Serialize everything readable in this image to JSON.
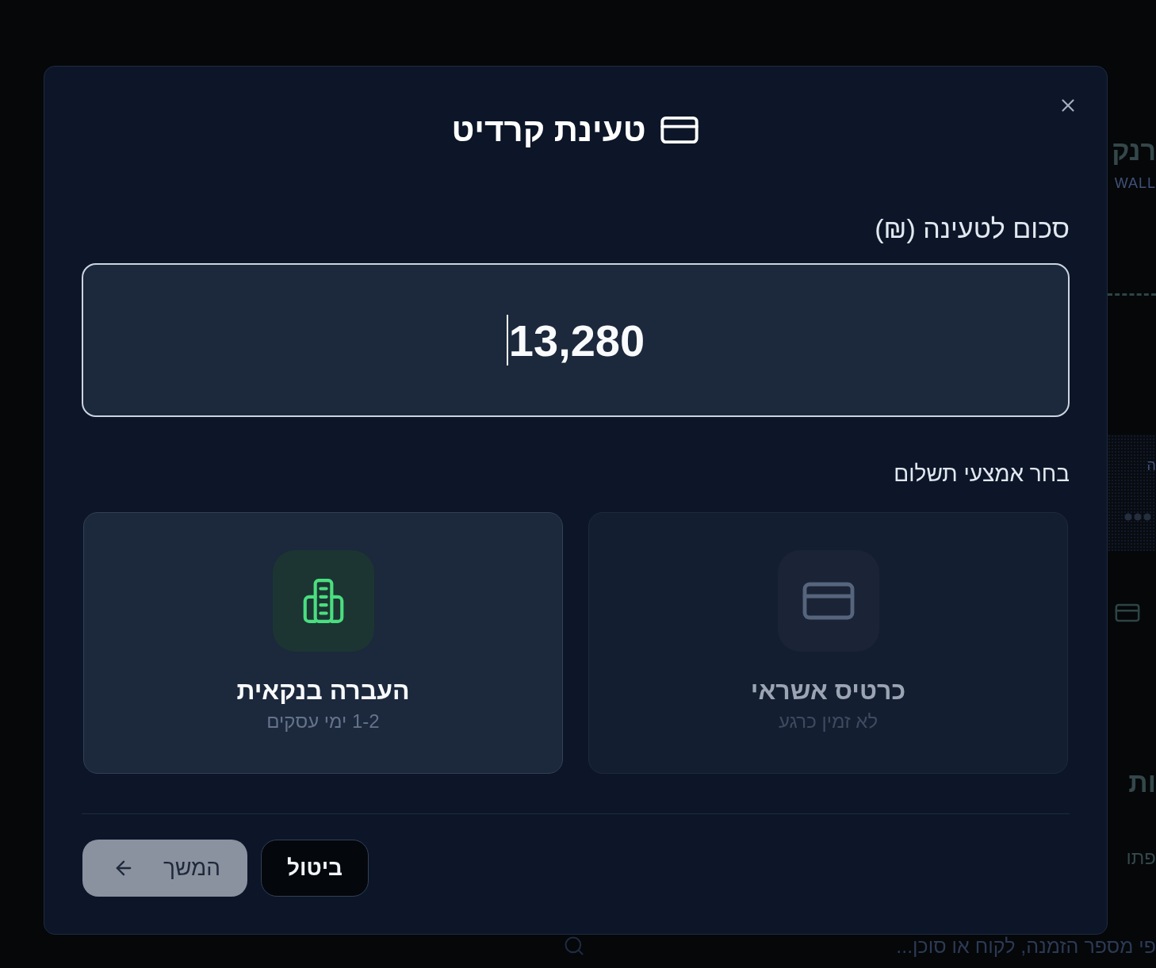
{
  "background": {
    "heading": "רנק",
    "subtitle": "WALL",
    "panel_text": "ה",
    "section_heading": "ות",
    "text": "פתו",
    "search": {
      "placeholder": "פי מספר הזמנה, לקוח או סוכן..."
    }
  },
  "dialog": {
    "title": "טעינת קרדיט",
    "amount": {
      "label": "סכום לטעינה (₪)",
      "value": "13,280",
      "focused": true
    },
    "payment": {
      "label": "בחר אמצעי תשלום",
      "methods": [
        {
          "kind": "card",
          "title": "כרטיס אשראי",
          "subtitle": "לא זמין כרגע",
          "disabled": true,
          "selected": false
        },
        {
          "kind": "bank",
          "title": "העברה בנקאית",
          "subtitle": "1-2 ימי עסקים",
          "disabled": false,
          "selected": false
        }
      ]
    },
    "buttons": [
      {
        "kind": "cancel",
        "label": "ביטול",
        "disabled": false
      },
      {
        "kind": "next",
        "label": "המשך",
        "disabled": true
      }
    ]
  }
}
